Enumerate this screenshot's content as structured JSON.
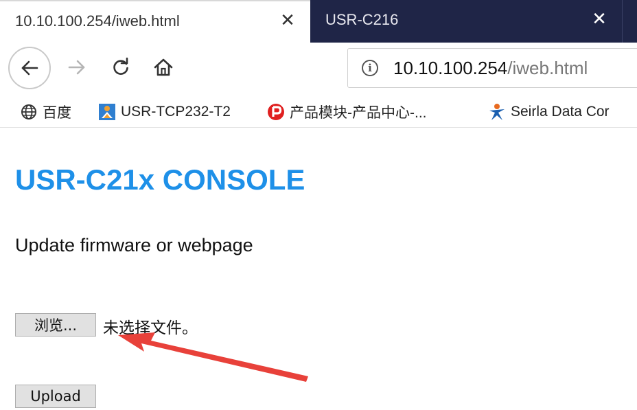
{
  "browser": {
    "tabs": [
      {
        "title": "10.10.100.254/iweb.html",
        "active": true
      },
      {
        "title": "USR-C216",
        "active": false
      }
    ],
    "tab_close_glyph": "✕",
    "nav": {
      "back_icon": "back-arrow-icon",
      "forward_icon": "forward-arrow-icon",
      "reload_icon": "reload-icon",
      "home_icon": "home-icon"
    },
    "url": {
      "info_glyph": "i",
      "host": "10.10.100.254",
      "path": "/iweb.html"
    },
    "bookmarks": [
      {
        "label": "百度",
        "icon": "globe-icon"
      },
      {
        "label": "USR-TCP232-T2",
        "icon": "usr-logo-icon"
      },
      {
        "label": "产品模块-产品中心-...",
        "icon": "p-logo-icon"
      },
      {
        "label": "Seirla Data Cor",
        "icon": "person-star-icon"
      }
    ],
    "colors": {
      "tabstrip_bg": "#1f2547",
      "title_blue": "#1e90e8",
      "annotation_red": "#e8413a"
    }
  },
  "page": {
    "title": "USR-C21x CONSOLE",
    "subtitle": "Update firmware or webpage",
    "browse_button": "浏览...",
    "file_status": "未选择文件。",
    "upload_button": "Upload"
  }
}
